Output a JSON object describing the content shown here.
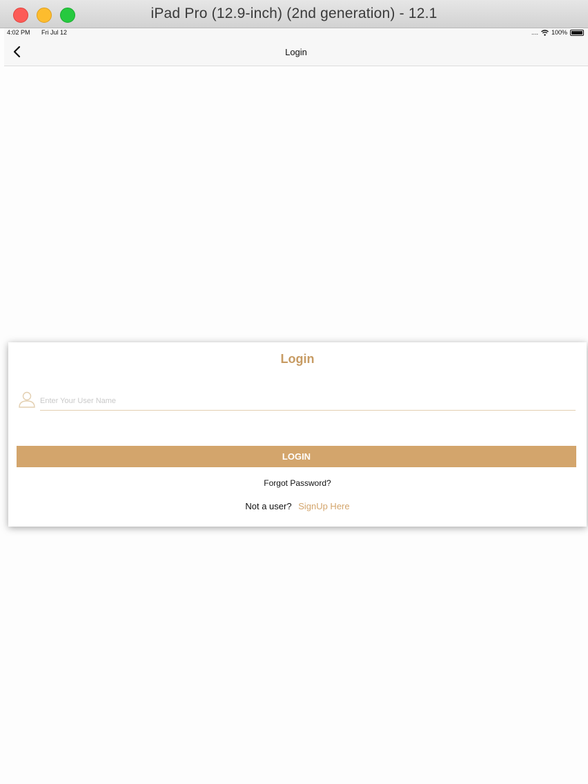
{
  "window": {
    "title": "iPad Pro (12.9-inch) (2nd generation) - 12.1"
  },
  "status_bar": {
    "time": "4:02 PM",
    "date": "Fri Jul 12",
    "signal": "....",
    "battery": "100%"
  },
  "nav_bar": {
    "title": "Login",
    "back_icon": "chevron-left-icon"
  },
  "login_card": {
    "title": "Login",
    "username": {
      "icon": "user-icon",
      "placeholder": "Enter Your User Name",
      "value": ""
    },
    "login_button_label": "LOGIN",
    "forgot_password_label": "Forgot Password?",
    "not_user_label": "Not a user?",
    "signup_label": "SignUp Here"
  },
  "colors": {
    "accent": "#d3a56c",
    "title": "#c79b63"
  }
}
